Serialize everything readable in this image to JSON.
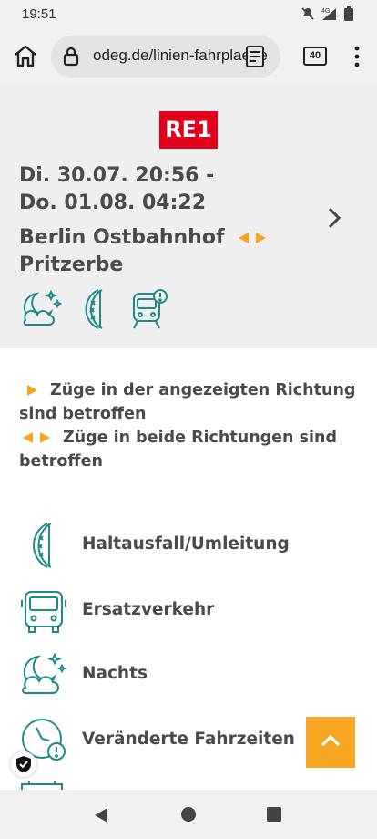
{
  "status_bar": {
    "time": "19:51"
  },
  "browser": {
    "url": "odeg.de/linien-fahrplaene",
    "tab_count": "40"
  },
  "hero": {
    "line_badge": "RE1",
    "date_range": "Di. 30.07. 20:56 - Do. 01.08. 04:22",
    "origin": "Berlin Ostbahnhof",
    "destination": "Pritzerbe"
  },
  "legend": {
    "one_direction": "Züge in der angezeigten Richtung sind betroffen",
    "both_directions": "Züge in beide Richtungen sind betroffen"
  },
  "categories": [
    {
      "label": "Haltausfall/Umleitung",
      "icon": "detour-icon"
    },
    {
      "label": "Ersatzverkehr",
      "icon": "bus-icon"
    },
    {
      "label": "Nachts",
      "icon": "night-icon"
    },
    {
      "label": "Veränderte Fahrzeiten",
      "icon": "clock-alert-icon"
    }
  ],
  "colors": {
    "accent": "#f6a623",
    "teal": "#1f8a8a",
    "badge_red": "#e2001a",
    "text": "#4a4a4a"
  }
}
